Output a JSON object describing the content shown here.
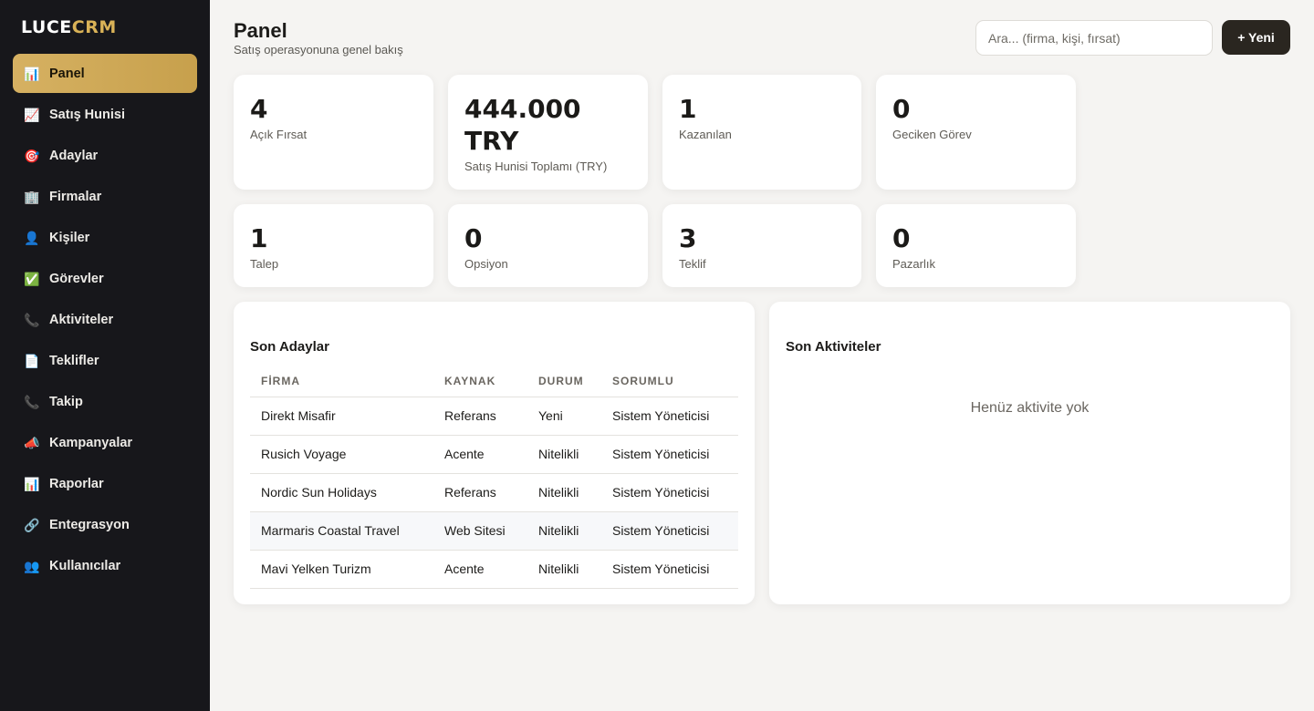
{
  "brand": {
    "part1": "LUCE",
    "part2": "CRM"
  },
  "sidebar": {
    "items": [
      {
        "label": "Panel",
        "icon": "📊",
        "icon_name": "bar-chart-icon",
        "active": true
      },
      {
        "label": "Satış Hunisi",
        "icon": "📈",
        "icon_name": "chart-up-icon"
      },
      {
        "label": "Adaylar",
        "icon": "🎯",
        "icon_name": "target-icon"
      },
      {
        "label": "Firmalar",
        "icon": "🏢",
        "icon_name": "building-icon"
      },
      {
        "label": "Kişiler",
        "icon": "👤",
        "icon_name": "person-icon"
      },
      {
        "label": "Görevler",
        "icon": "✅",
        "icon_name": "check-icon"
      },
      {
        "label": "Aktiviteler",
        "icon": "📞",
        "icon_name": "phone-icon"
      },
      {
        "label": "Teklifler",
        "icon": "📄",
        "icon_name": "document-icon"
      },
      {
        "label": "Takip",
        "icon": "📞",
        "icon_name": "phone-icon"
      },
      {
        "label": "Kampanyalar",
        "icon": "📣",
        "icon_name": "megaphone-icon"
      },
      {
        "label": "Raporlar",
        "icon": "📊",
        "icon_name": "bar-chart-icon"
      },
      {
        "label": "Entegrasyon",
        "icon": "🔗",
        "icon_name": "link-icon"
      },
      {
        "label": "Kullanıcılar",
        "icon": "👥",
        "icon_name": "users-icon"
      }
    ]
  },
  "header": {
    "title": "Panel",
    "subtitle": "Satış operasyonuna genel bakış",
    "search_placeholder": "Ara... (firma, kişi, fırsat)",
    "new_button": "+ Yeni"
  },
  "stats": [
    {
      "value": "4",
      "label": "Açık Fırsat"
    },
    {
      "value": "444.000 TRY",
      "label": "Satış Hunisi Toplamı (TRY)"
    },
    {
      "value": "1",
      "label": "Kazanılan"
    },
    {
      "value": "0",
      "label": "Geciken Görev"
    },
    {
      "value": "1",
      "label": "Talep"
    },
    {
      "value": "0",
      "label": "Opsiyon"
    },
    {
      "value": "3",
      "label": "Teklif"
    },
    {
      "value": "0",
      "label": "Pazarlık"
    }
  ],
  "leads": {
    "title": "Son Adaylar",
    "columns": [
      "FİRMA",
      "KAYNAK",
      "DURUM",
      "SORUMLU"
    ],
    "rows": [
      [
        "Direkt Misafir",
        "Referans",
        "Yeni",
        "Sistem Yöneticisi"
      ],
      [
        "Rusich Voyage",
        "Acente",
        "Nitelikli",
        "Sistem Yöneticisi"
      ],
      [
        "Nordic Sun Holidays",
        "Referans",
        "Nitelikli",
        "Sistem Yöneticisi"
      ],
      [
        "Marmaris Coastal Travel",
        "Web Sitesi",
        "Nitelikli",
        "Sistem Yöneticisi"
      ],
      [
        "Mavi Yelken Turizm",
        "Acente",
        "Nitelikli",
        "Sistem Yöneticisi"
      ]
    ]
  },
  "activities": {
    "title": "Son Aktiviteler",
    "empty": "Henüz aktivite yok"
  },
  "colors": {
    "sidebar_bg": "#17171b",
    "accent_gold": "#d6b162",
    "button_dark": "#2a2620",
    "page_bg": "#f5f4f2"
  }
}
